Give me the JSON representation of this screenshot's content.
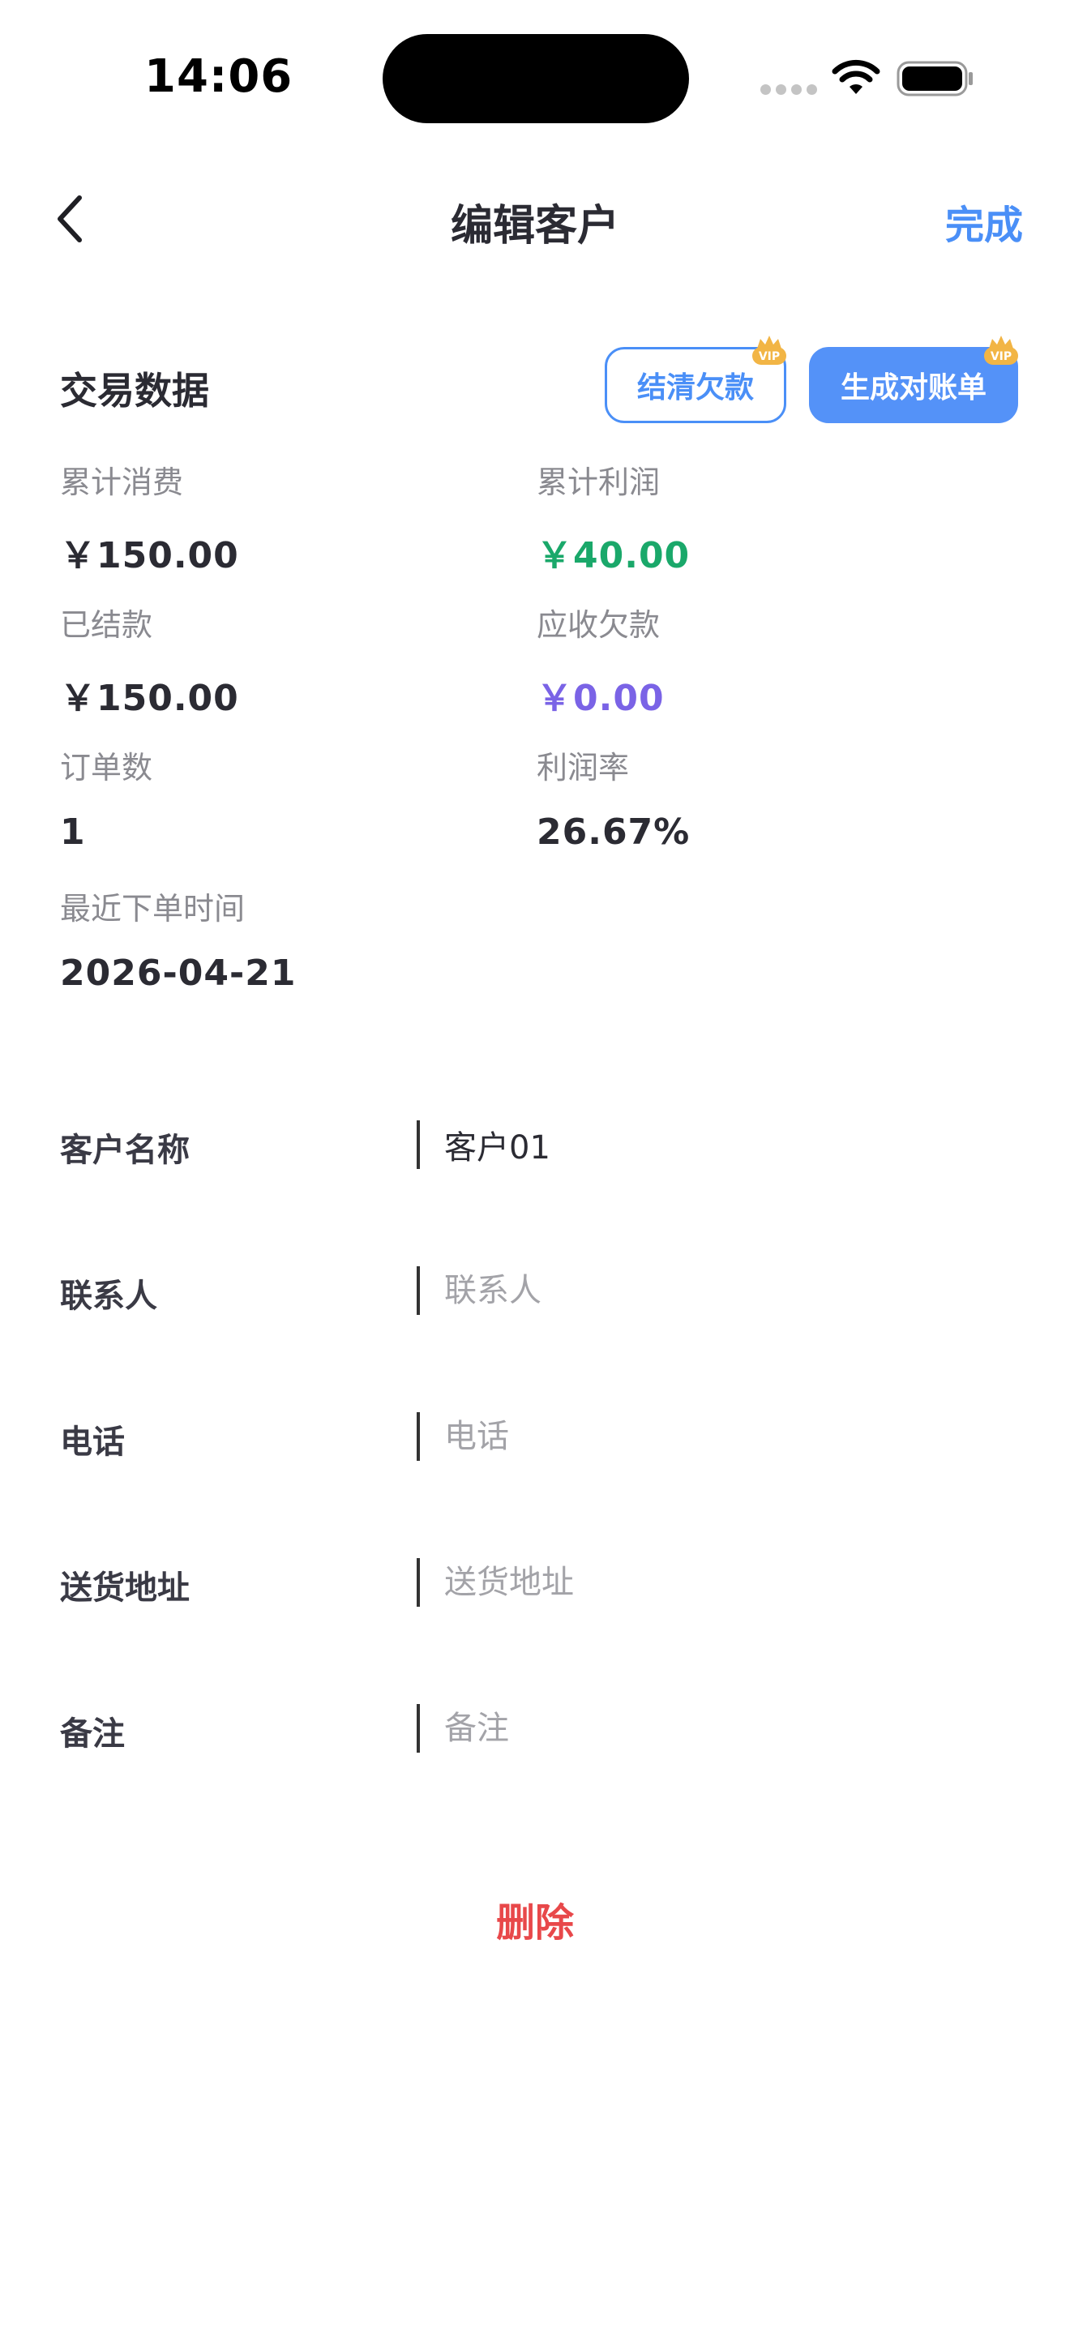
{
  "status_bar": {
    "time": "14:06"
  },
  "nav": {
    "title": "编辑客户",
    "done_label": "完成"
  },
  "trade_data": {
    "title": "交易数据",
    "settle_button_label": "结清欠款",
    "statement_button_label": "生成对账单",
    "vip_badge_text": "VIP",
    "stats": {
      "total_spend": {
        "label": "累计消费",
        "value": "￥150.00"
      },
      "total_profit": {
        "label": "累计利润",
        "value": "￥40.00"
      },
      "settled": {
        "label": "已结款",
        "value": "￥150.00"
      },
      "receivable": {
        "label": "应收欠款",
        "value": "￥0.00"
      },
      "order_count": {
        "label": "订单数",
        "value": "1"
      },
      "profit_rate": {
        "label": "利润率",
        "value": "26.67%"
      },
      "last_order": {
        "label": "最近下单时间",
        "value": "2026-04-21"
      }
    }
  },
  "form": {
    "customer_name": {
      "label": "客户名称",
      "value": "客户01",
      "placeholder": "客户名称"
    },
    "contact": {
      "label": "联系人",
      "value": "",
      "placeholder": "联系人"
    },
    "phone": {
      "label": "电话",
      "value": "",
      "placeholder": "电话"
    },
    "address": {
      "label": "送货地址",
      "value": "",
      "placeholder": "送货地址"
    },
    "remark": {
      "label": "备注",
      "value": "",
      "placeholder": "备注"
    }
  },
  "delete_label": "删除",
  "colors": {
    "accent": "#4a8ff7",
    "profit_green": "#1aa86a",
    "receivable_purple": "#7a63e6",
    "delete_red": "#e8484a",
    "vip_gold": "#f2b545"
  }
}
